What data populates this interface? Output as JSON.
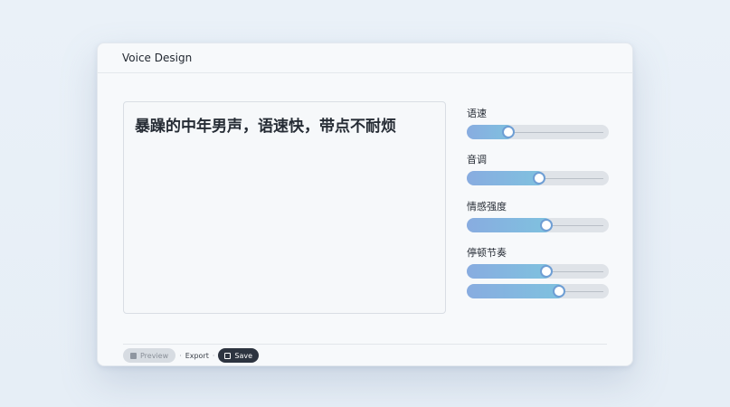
{
  "window": {
    "title": "Voice Design"
  },
  "prompt": {
    "text": "暴躁的中年男声，语速快，带点不耐烦"
  },
  "sliders": [
    {
      "label": "语速",
      "value": 0.29
    },
    {
      "label": "音调",
      "value": 0.51
    },
    {
      "label": "情感强度",
      "value": 0.56
    },
    {
      "label": "停顿节奏",
      "value": 0.56
    },
    {
      "label": "",
      "value": 0.65
    }
  ],
  "footer": {
    "preview_label": "Preview",
    "export_label": "Export",
    "save_label": "Save",
    "separator": "·"
  },
  "colors": {
    "accent_start": "#88ace0",
    "accent_end": "#7fc2df",
    "save_bg": "#2d3440"
  }
}
